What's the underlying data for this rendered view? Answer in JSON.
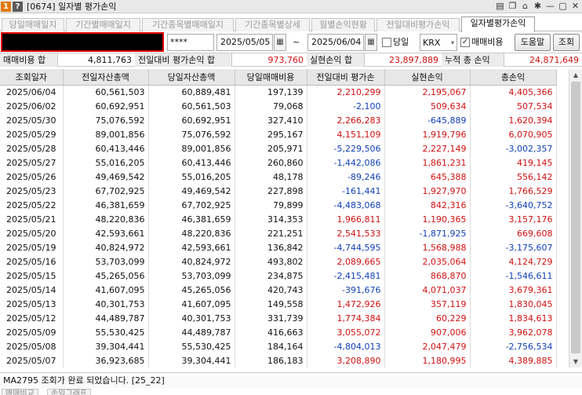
{
  "window": {
    "title": "[0674] 일자별 평가손익",
    "badge": "1",
    "help": "?",
    "icons": [
      "list-icon",
      "window-icon",
      "camera-icon",
      "gear-icon",
      "minimize-icon",
      "restore-icon",
      "close-icon"
    ],
    "icon_glyphs": [
      "▤",
      "❐",
      "⌂",
      "✱",
      "—",
      "▢",
      "✕"
    ]
  },
  "tabs": [
    {
      "label": "당일매매일지",
      "active": false
    },
    {
      "label": "기간별매매일지",
      "active": false
    },
    {
      "label": "기간종목별매매일지",
      "active": false
    },
    {
      "label": "기간종목별상세",
      "active": false
    },
    {
      "label": "월별손익현황",
      "active": false
    },
    {
      "label": "전일대비평가손익",
      "active": false
    },
    {
      "label": "일자별평가손익",
      "active": true
    }
  ],
  "controls": {
    "password": "****",
    "start_date": "2025/05/05",
    "tilde": "~",
    "end_date": "2025/06/04",
    "today_label": "당일",
    "today_checked": false,
    "exchange": "KRX",
    "fee_label": "매매비용",
    "fee_checked": true,
    "help_button": "도움말",
    "query_button": "조회",
    "calendar_glyph": "▦",
    "check_glyph": "✓",
    "arrow_glyph": "▾"
  },
  "summary": {
    "fee_total_label": "매매비용 합",
    "fee_total": "4,811,763",
    "prev_eval_label": "전일대비 평가손익 합",
    "prev_eval": "973,760",
    "realized_label": "실현손익 합",
    "realized": "23,897,889",
    "cumulative_label": "누적 총 손익",
    "cumulative": "24,871,649"
  },
  "table": {
    "headers": [
      "조회일자",
      "전일자산총액",
      "당일자산총액",
      "당일매매비용",
      "전일대비 평가손",
      "실현손익",
      "총손익"
    ],
    "rows": [
      [
        "2025/06/04",
        "60,561,503",
        "60,889,481",
        "197,139",
        "2,210,299",
        "2,195,067",
        "4,405,366"
      ],
      [
        "2025/06/02",
        "60,692,951",
        "60,561,503",
        "79,068",
        "-2,100",
        "509,634",
        "507,534"
      ],
      [
        "2025/05/30",
        "75,076,592",
        "60,692,951",
        "327,410",
        "2,266,283",
        "-645,889",
        "1,620,394"
      ],
      [
        "2025/05/29",
        "89,001,856",
        "75,076,592",
        "295,167",
        "4,151,109",
        "1,919,796",
        "6,070,905"
      ],
      [
        "2025/05/28",
        "60,413,446",
        "89,001,856",
        "205,971",
        "-5,229,506",
        "2,227,149",
        "-3,002,357"
      ],
      [
        "2025/05/27",
        "55,016,205",
        "60,413,446",
        "260,860",
        "-1,442,086",
        "1,861,231",
        "419,145"
      ],
      [
        "2025/05/26",
        "49,469,542",
        "55,016,205",
        "48,178",
        "-89,246",
        "645,388",
        "556,142"
      ],
      [
        "2025/05/23",
        "67,702,925",
        "49,469,542",
        "227,898",
        "-161,441",
        "1,927,970",
        "1,766,529"
      ],
      [
        "2025/05/22",
        "46,381,659",
        "67,702,925",
        "79,899",
        "-4,483,068",
        "842,316",
        "-3,640,752"
      ],
      [
        "2025/05/21",
        "48,220,836",
        "46,381,659",
        "314,353",
        "1,966,811",
        "1,190,365",
        "3,157,176"
      ],
      [
        "2025/05/20",
        "42,593,661",
        "48,220,836",
        "221,251",
        "2,541,533",
        "-1,871,925",
        "669,608"
      ],
      [
        "2025/05/19",
        "40,824,972",
        "42,593,661",
        "136,842",
        "-4,744,595",
        "1,568,988",
        "-3,175,607"
      ],
      [
        "2025/05/16",
        "53,703,099",
        "40,824,972",
        "493,802",
        "2,089,665",
        "2,035,064",
        "4,124,729"
      ],
      [
        "2025/05/15",
        "45,265,056",
        "53,703,099",
        "234,875",
        "-2,415,481",
        "868,870",
        "-1,546,611"
      ],
      [
        "2025/05/14",
        "41,607,095",
        "45,265,056",
        "420,743",
        "-391,676",
        "4,071,037",
        "3,679,361"
      ],
      [
        "2025/05/13",
        "40,301,753",
        "41,607,095",
        "149,558",
        "1,472,926",
        "357,119",
        "1,830,045"
      ],
      [
        "2025/05/12",
        "44,489,787",
        "40,301,753",
        "331,739",
        "1,774,384",
        "60,229",
        "1,834,613"
      ],
      [
        "2025/05/09",
        "55,530,425",
        "44,489,787",
        "416,663",
        "3,055,072",
        "907,006",
        "3,962,078"
      ],
      [
        "2025/05/08",
        "39,304,441",
        "55,530,425",
        "184,164",
        "-4,804,013",
        "2,047,479",
        "-2,756,534"
      ],
      [
        "2025/05/07",
        "36,923,685",
        "39,304,441",
        "186,183",
        "3,208,890",
        "1,180,995",
        "4,389,885"
      ]
    ]
  },
  "status": {
    "message": "MA2795 조회가 완료 되었습니다. [25_22]"
  },
  "bottom_tabs": [
    "매매비교",
    "손익그래프"
  ],
  "colors": {
    "positive": "#d01010",
    "negative": "#1040b8",
    "accent": "#e07a10"
  }
}
